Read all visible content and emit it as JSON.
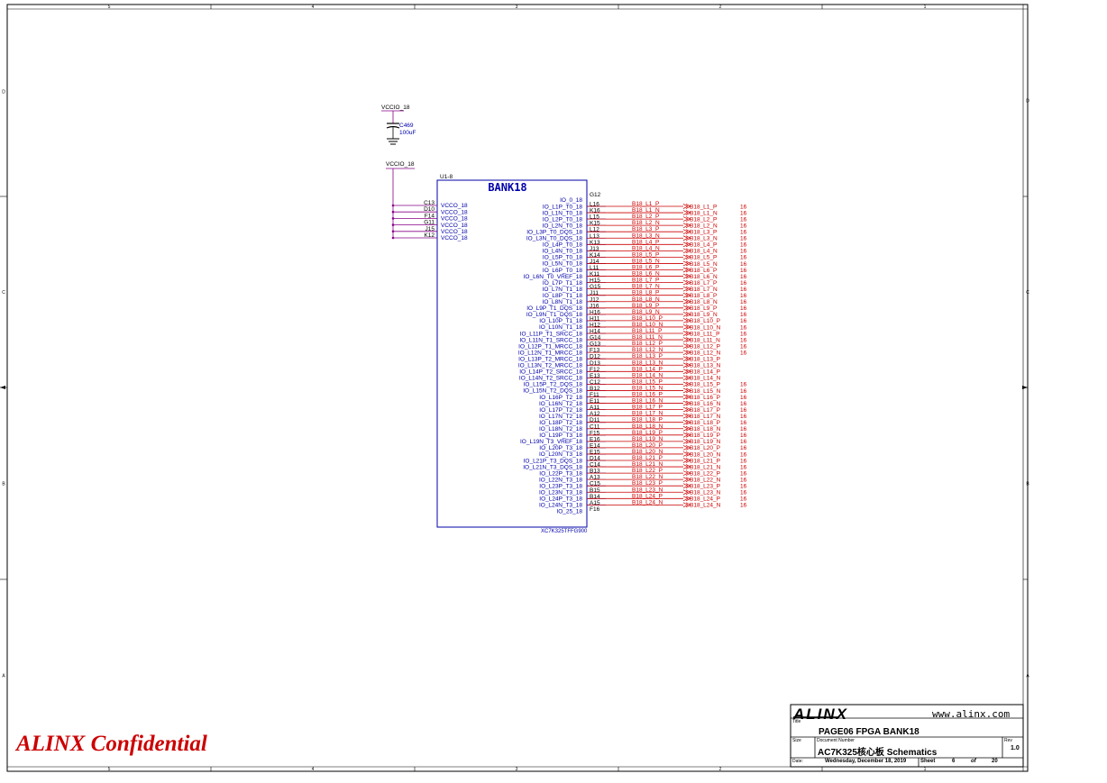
{
  "frame": {
    "top_zones": [
      "5",
      "4",
      "3",
      "2",
      "1"
    ],
    "bottom_zones": [
      "5",
      "4",
      "3",
      "2",
      "1"
    ],
    "left_zones": [
      "D",
      "C",
      "B",
      "A"
    ],
    "right_zones": [
      "D",
      "C",
      "B",
      "A"
    ]
  },
  "capacitor": {
    "net": "VCCIO_18",
    "ref": "C469",
    "value": "100uF"
  },
  "supply_net": "VCCIO_18",
  "chip": {
    "ref": "U1-8",
    "bank": "BANK18",
    "part": "XC7K325TFFG900",
    "pin_g12": "G12",
    "vcco_pins": [
      {
        "pin": "C13",
        "name": "VCCO_18"
      },
      {
        "pin": "D10",
        "name": "VCCO_18"
      },
      {
        "pin": "F14",
        "name": "VCCO_18"
      },
      {
        "pin": "G11",
        "name": "VCCO_18"
      },
      {
        "pin": "J15",
        "name": "VCCO_18"
      },
      {
        "pin": "K12",
        "name": "VCCO_18"
      }
    ],
    "io_pins": [
      {
        "name": "IO_0_18",
        "pin": "L16",
        "net": "B18_L1_P",
        "port": "B18_L1_P",
        "page": "16"
      },
      {
        "name": "IO_L1P_T0_18",
        "pin": "K16",
        "net": "B18_L1_N",
        "port": "B18_L1_N",
        "page": "16"
      },
      {
        "name": "IO_L1N_T0_18",
        "pin": "L15",
        "net": "B18_L2_P",
        "port": "B18_L2_P",
        "page": "16"
      },
      {
        "name": "IO_L2P_T0_18",
        "pin": "K15",
        "net": "B18_L2_N",
        "port": "B18_L2_N",
        "page": "16"
      },
      {
        "name": "IO_L2N_T0_18",
        "pin": "L12",
        "net": "B18_L3_P",
        "port": "B18_L3_P",
        "page": "16"
      },
      {
        "name": "IO_L3P_T0_DQS_18",
        "pin": "L13",
        "net": "B18_L3_N",
        "port": "B18_L3_N",
        "page": "16"
      },
      {
        "name": "IO_L3N_T0_DQS_18",
        "pin": "K13",
        "net": "B18_L4_P",
        "port": "B18_L4_P",
        "page": "16"
      },
      {
        "name": "IO_L4P_T0_18",
        "pin": "J13",
        "net": "B18_L4_N",
        "port": "B18_L4_N",
        "page": "16"
      },
      {
        "name": "IO_L4N_T0_18",
        "pin": "K14",
        "net": "B18_L5_P",
        "port": "B18_L5_P",
        "page": "16"
      },
      {
        "name": "IO_L5P_T0_18",
        "pin": "J14",
        "net": "B18_L5_N",
        "port": "B18_L5_N",
        "page": "16"
      },
      {
        "name": "IO_L5N_T0_18",
        "pin": "L11",
        "net": "B18_L6_P",
        "port": "B18_L6_P",
        "page": "16"
      },
      {
        "name": "IO_L6P_T0_18",
        "pin": "K11",
        "net": "B18_L6_N",
        "port": "B18_L6_N",
        "page": "16"
      },
      {
        "name": "IO_L6N_T0_VREF_18",
        "pin": "H15",
        "net": "B18_L7_P",
        "port": "B18_L7_P",
        "page": "16"
      },
      {
        "name": "IO_L7P_T1_18",
        "pin": "G15",
        "net": "B18_L7_N",
        "port": "B18_L7_N",
        "page": "16"
      },
      {
        "name": "IO_L7N_T1_18",
        "pin": "J11",
        "net": "B18_L8_P",
        "port": "B18_L8_P",
        "page": "16"
      },
      {
        "name": "IO_L8P_T1_18",
        "pin": "J12",
        "net": "B18_L8_N",
        "port": "B18_L8_N",
        "page": "16"
      },
      {
        "name": "IO_L8N_T1_18",
        "pin": "J16",
        "net": "B18_L9_P",
        "port": "B18_L9_P",
        "page": "16"
      },
      {
        "name": "IO_L9P_T1_DQS_18",
        "pin": "H16",
        "net": "B18_L9_N",
        "port": "B18_L9_N",
        "page": "16"
      },
      {
        "name": "IO_L9N_T1_DQS_18",
        "pin": "H11",
        "net": "B18_L10_P",
        "port": "B18_L10_P",
        "page": "16"
      },
      {
        "name": "IO_L10P_T1_18",
        "pin": "H12",
        "net": "B18_L10_N",
        "port": "B18_L10_N",
        "page": "16"
      },
      {
        "name": "IO_L10N_T1_18",
        "pin": "H14",
        "net": "B18_L11_P",
        "port": "B18_L11_P",
        "page": "16"
      },
      {
        "name": "IO_L11P_T1_SRCC_18",
        "pin": "G14",
        "net": "B18_L11_N",
        "port": "B18_L11_N",
        "page": "16"
      },
      {
        "name": "IO_L11N_T1_SRCC_18",
        "pin": "G13",
        "net": "B18_L12_P",
        "port": "B18_L12_P",
        "page": "16"
      },
      {
        "name": "IO_L12P_T1_MRCC_18",
        "pin": "F13",
        "net": "B18_L12_N",
        "port": "B18_L12_N",
        "page": "16"
      },
      {
        "name": "IO_L12N_T1_MRCC_18",
        "pin": "D12",
        "net": "B18_L13_P",
        "port": "B18_L13_P",
        "page": ""
      },
      {
        "name": "IO_L13P_T2_MRCC_18",
        "pin": "D13",
        "net": "B18_L13_N",
        "port": "B18_L13_N",
        "page": ""
      },
      {
        "name": "IO_L13N_T2_MRCC_18",
        "pin": "F12",
        "net": "B18_L14_P",
        "port": "B18_L14_P",
        "page": ""
      },
      {
        "name": "IO_L14P_T2_SRCC_18",
        "pin": "E13",
        "net": "B18_L14_N",
        "port": "B18_L14_N",
        "page": ""
      },
      {
        "name": "IO_L14N_T2_SRCC_18",
        "pin": "C12",
        "net": "B18_L15_P",
        "port": "B18_L15_P",
        "page": "16"
      },
      {
        "name": "IO_L15P_T2_DQS_18",
        "pin": "B12",
        "net": "B18_L15_N",
        "port": "B18_L15_N",
        "page": "16"
      },
      {
        "name": "IO_L15N_T2_DQS_18",
        "pin": "F11",
        "net": "B18_L16_P",
        "port": "B18_L16_P",
        "page": "16"
      },
      {
        "name": "IO_L16P_T2_18",
        "pin": "E11",
        "net": "B18_L16_N",
        "port": "B18_L16_N",
        "page": "16"
      },
      {
        "name": "IO_L16N_T2_18",
        "pin": "A11",
        "net": "B18_L17_P",
        "port": "B18_L17_P",
        "page": "16"
      },
      {
        "name": "IO_L17P_T2_18",
        "pin": "A12",
        "net": "B18_L17_N",
        "port": "B18_L17_N",
        "page": "16"
      },
      {
        "name": "IO_L17N_T2_18",
        "pin": "D11",
        "net": "B18_L18_P",
        "port": "B18_L18_P",
        "page": "16"
      },
      {
        "name": "IO_L18P_T2_18",
        "pin": "C11",
        "net": "B18_L18_N",
        "port": "B18_L18_N",
        "page": "16"
      },
      {
        "name": "IO_L18N_T2_18",
        "pin": "F15",
        "net": "B18_L19_P",
        "port": "B18_L19_P",
        "page": "16"
      },
      {
        "name": "IO_L19P_T3_18",
        "pin": "E16",
        "net": "B18_L19_N",
        "port": "B18_L19_N",
        "page": "16"
      },
      {
        "name": "IO_L19N_T3_VREF_18",
        "pin": "E14",
        "net": "B18_L20_P",
        "port": "B18_L20_P",
        "page": "16"
      },
      {
        "name": "IO_L20P_T3_18",
        "pin": "E15",
        "net": "B18_L20_N",
        "port": "B18_L20_N",
        "page": "16"
      },
      {
        "name": "IO_L20N_T3_18",
        "pin": "D14",
        "net": "B18_L21_P",
        "port": "B18_L21_P",
        "page": "16"
      },
      {
        "name": "IO_L21P_T3_DQS_18",
        "pin": "C14",
        "net": "B18_L21_N",
        "port": "B18_L21_N",
        "page": "16"
      },
      {
        "name": "IO_L21N_T3_DQS_18",
        "pin": "B13",
        "net": "B18_L22_P",
        "port": "B18_L22_P",
        "page": "16"
      },
      {
        "name": "IO_L22P_T3_18",
        "pin": "A13",
        "net": "B18_L22_N",
        "port": "B18_L22_N",
        "page": "16"
      },
      {
        "name": "IO_L22N_T3_18",
        "pin": "C15",
        "net": "B18_L23_P",
        "port": "B18_L23_P",
        "page": "16"
      },
      {
        "name": "IO_L23P_T3_18",
        "pin": "B15",
        "net": "B18_L23_N",
        "port": "B18_L23_N",
        "page": "16"
      },
      {
        "name": "IO_L23N_T3_18",
        "pin": "B14",
        "net": "B18_L24_P",
        "port": "B18_L24_P",
        "page": "16"
      },
      {
        "name": "IO_L24P_T3_18",
        "pin": "A15",
        "net": "B18_L24_N",
        "port": "B18_L24_N",
        "page": "16"
      },
      {
        "name": "IO_L24N_T3_18",
        "pin": "F16",
        "net": "",
        "port": "",
        "page": ""
      },
      {
        "name": "IO_25_18",
        "pin": "",
        "net": "",
        "port": "",
        "page": ""
      }
    ]
  },
  "confidential": "ALINX Confidential",
  "title_block": {
    "logo": "ALINX",
    "url": "www.alinx.com",
    "title_label": "Title",
    "title": "PAGE06 FPGA BANK18",
    "size_label": "Size",
    "docnum_label": "Document Number",
    "docnum": "AC7K325核心板 Schematics",
    "rev_label": "Rev",
    "rev": "1.0",
    "date_label": "Date:",
    "date": "Wednesday, December 18, 2019",
    "sheet_label": "Sheet",
    "sheet": "6",
    "of_label": "of",
    "total": "20"
  },
  "colors": {
    "wire": "#cc0000",
    "symbol": "#0000aa",
    "power": "#880088",
    "text": "#000000",
    "blue_text": "#0000aa"
  }
}
